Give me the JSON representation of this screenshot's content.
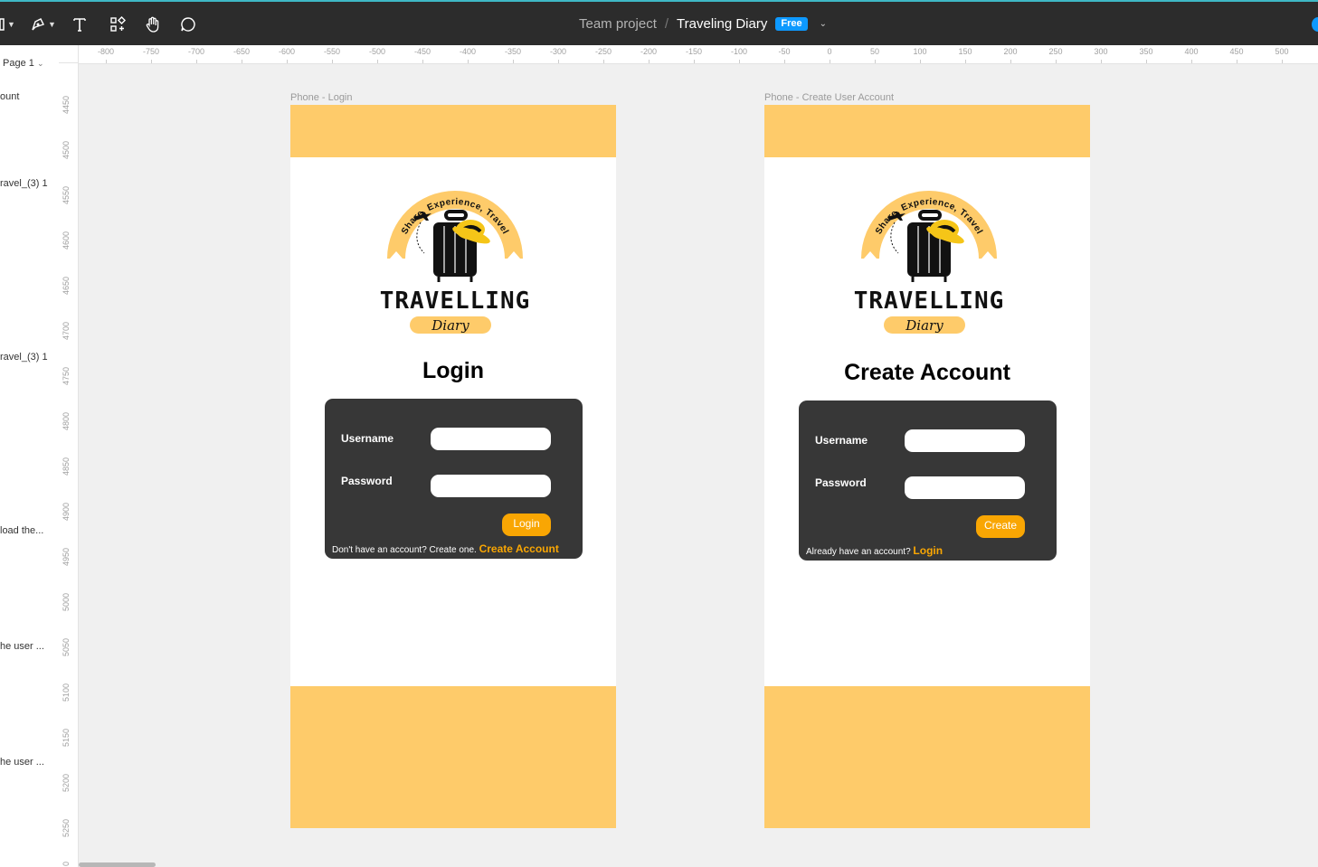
{
  "toolbar": {
    "breadcrumb_team": "Team project",
    "breadcrumb_sep": "/",
    "file_name": "Traveling Diary",
    "plan_badge": "Free"
  },
  "layers": {
    "page_selector": "Page 1",
    "items": [
      "ount",
      "ravel_(3) 1",
      "ravel_(3) 1",
      " load the...",
      "he user ...",
      "he user ..."
    ]
  },
  "ruler": {
    "horizontal": [
      "-800",
      "-750",
      "-700",
      "-650",
      "-600",
      "-550",
      "-500",
      "-450",
      "-400",
      "-350",
      "-300",
      "-250",
      "-200",
      "-150",
      "-100",
      "-50",
      "0",
      "50",
      "100",
      "150",
      "200",
      "250",
      "300",
      "350",
      "400",
      "450",
      "500"
    ],
    "vertical": [
      "4450",
      "4500",
      "4550",
      "4600",
      "4650",
      "4700",
      "4750",
      "4800",
      "4850",
      "4900",
      "4950",
      "5000",
      "5050",
      "5100",
      "5150",
      "5200",
      "5250",
      "0"
    ]
  },
  "frames": [
    {
      "label": "Phone - Login",
      "heading": "Login",
      "username_label": "Username",
      "password_label": "Password",
      "button": "Login",
      "footer_text": "Don't have an account? Create one.",
      "footer_link": "Create Account"
    },
    {
      "label": "Phone - Create User Account",
      "heading": "Create Account",
      "username_label": "Username",
      "password_label": "Password",
      "button": "Create",
      "footer_text": "Already have an account?",
      "footer_link": "Login"
    }
  ],
  "logo": {
    "arc_text": "Share, Experience, Travel",
    "wordmark": "TRAVELLING",
    "script": "Diary"
  },
  "colors": {
    "accent_yellow": "#fecb6a",
    "accent_orange": "#f9a603",
    "card_dark": "#373737",
    "editor_bar": "#2c2c2c",
    "badge_blue": "#0d99ff"
  }
}
